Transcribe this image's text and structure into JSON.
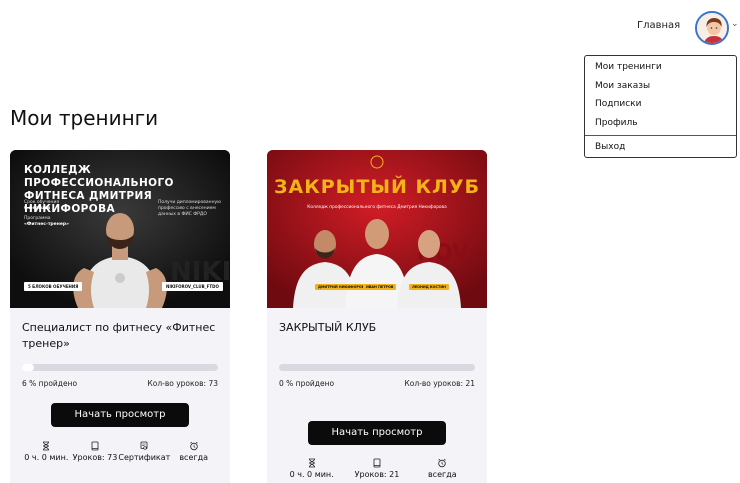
{
  "header": {
    "home_link": "Главная"
  },
  "user_menu": {
    "items": [
      "Мои тренинги",
      "Мои заказы",
      "Подписки",
      "Профиль"
    ],
    "logout": "Выход"
  },
  "page": {
    "title": "Мои тренинги"
  },
  "courses": [
    {
      "image": {
        "headline_line1": "КОЛЛЕДЖ ПРОФЕССИОНАЛЬНОГО",
        "headline_line2": "ФИТНЕСА ДМИТРИЯ НИКИФОРОВА",
        "term_label": "Срок обучения",
        "term_value": "6 месяцев",
        "program_label": "Программа",
        "program_value": "«Фитнес-тренер»",
        "diploma_line1": "Получи дипломированную",
        "diploma_line2": "профессию с внесением",
        "diploma_line3": "данных в ФИС ФРДО",
        "badge_left": "5 БЛОКОВ ОБУЧЕНИЯ",
        "badge_right": "NIKIFOROV_CLUB_FTDO"
      },
      "title": "Специалист по фитнесу «Фитнес тренер»",
      "progress_percent": 6,
      "progress_label": "6 % пройдено",
      "lessons_label": "Кол-во уроков: 73",
      "cta": "Начать просмотр",
      "stats": [
        {
          "icon": "hourglass-icon",
          "text": "0 ч. 0 мин."
        },
        {
          "icon": "book-icon",
          "text": "Уроков: 73"
        },
        {
          "icon": "certificate-icon",
          "text": "Сертификат"
        },
        {
          "icon": "alarm-clock-icon",
          "text": "всегда"
        }
      ]
    },
    {
      "image": {
        "headline": "ЗАКРЫТЫЙ КЛУБ",
        "subtitle": "Колледж профессионального фитнеса Дмитрия Никифорова",
        "tags": [
          "ДМИТРИЙ НИКИФОРОВ",
          "ИВАН ПЕТРОВ",
          "ЛЕОНИД КОСТИН"
        ]
      },
      "title": "ЗАКРЫТЫЙ КЛУБ",
      "progress_percent": 0,
      "progress_label": "0 % пройдено",
      "lessons_label": "Кол-во уроков: 21",
      "cta": "Начать просмотр",
      "stats": [
        {
          "icon": "hourglass-icon",
          "text": "0 ч. 0 мин."
        },
        {
          "icon": "book-icon",
          "text": "Уроков: 21"
        },
        {
          "icon": "alarm-clock-icon",
          "text": "всегда"
        }
      ]
    }
  ],
  "colors": {
    "accent_gold": "#f2b21a",
    "club_red": "#b8141c",
    "button_black": "#0b0b0b"
  }
}
